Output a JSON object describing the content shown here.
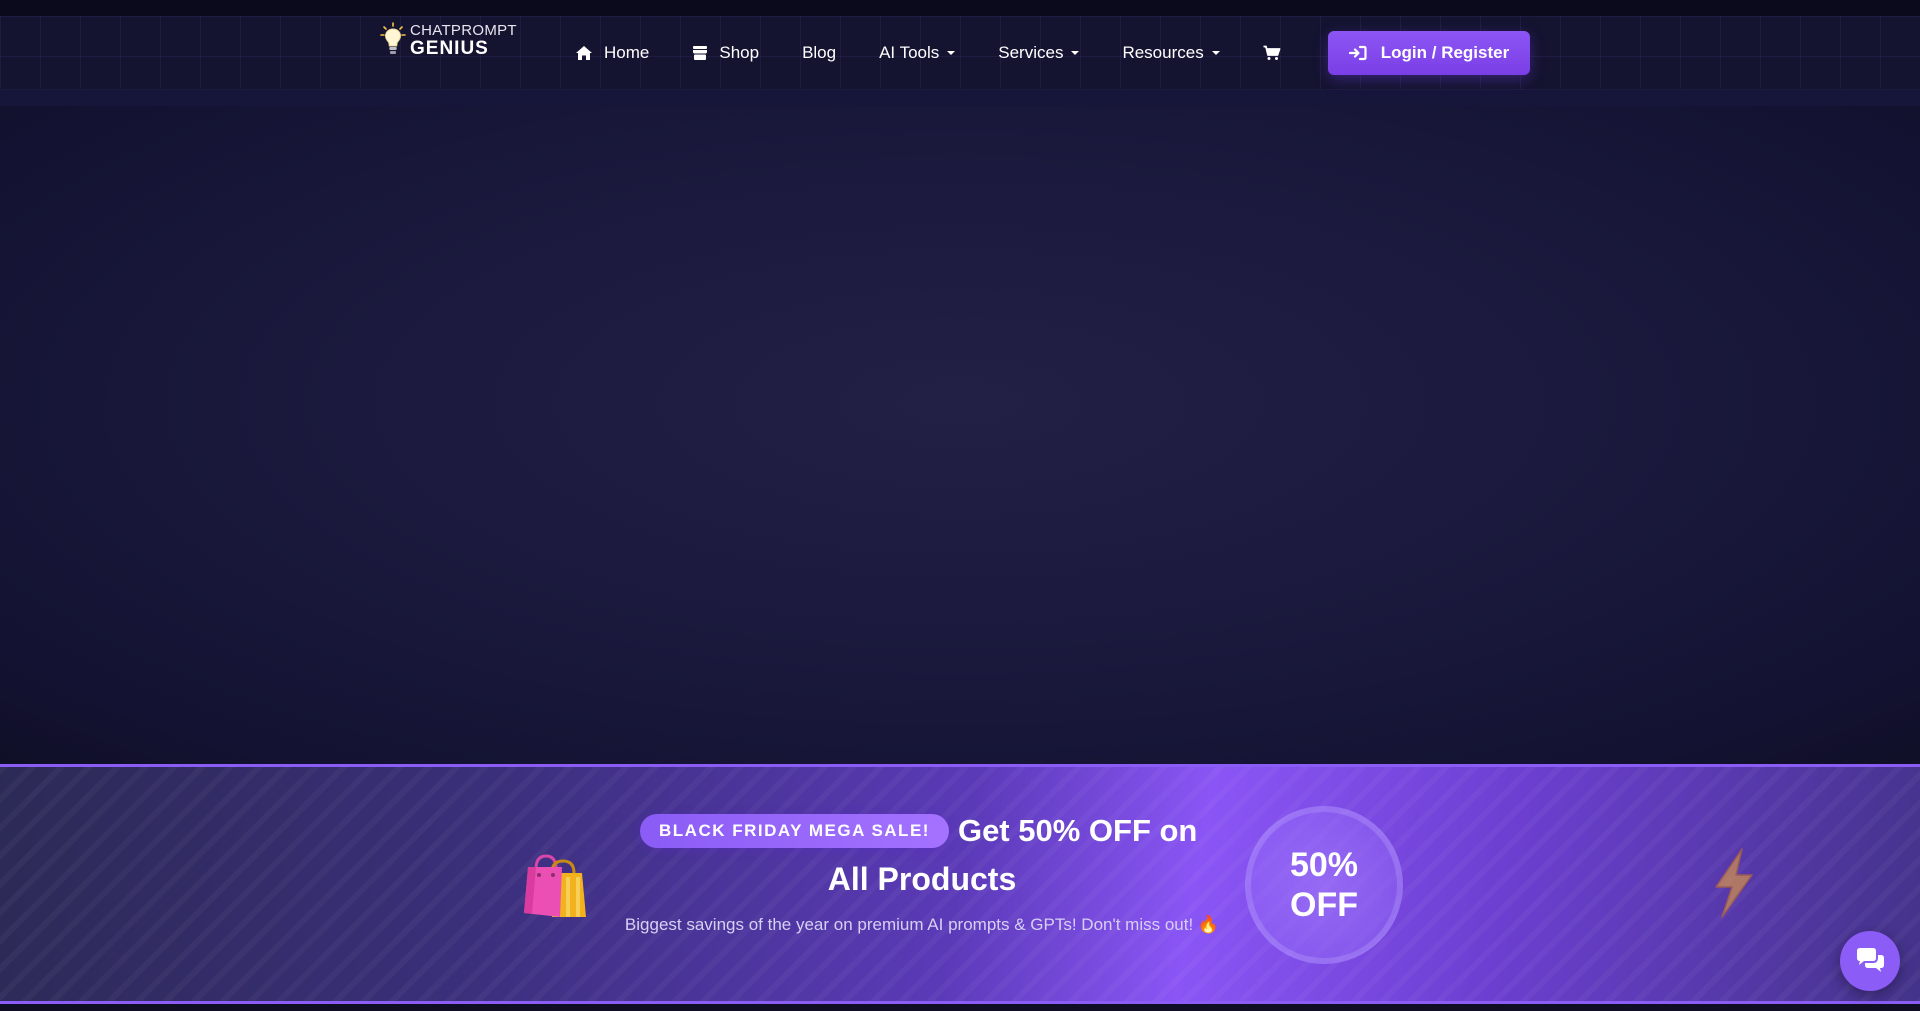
{
  "logo": {
    "line1": "CHATPROMPT",
    "line2": "GENIUS",
    "icon": "lightbulb-icon"
  },
  "nav": {
    "items": [
      {
        "label": "Home",
        "icon": "home-icon"
      },
      {
        "label": "Shop",
        "icon": "store-icon"
      },
      {
        "label": "Blog"
      },
      {
        "label": "AI Tools",
        "dropdown": true
      },
      {
        "label": "Services",
        "dropdown": true
      },
      {
        "label": "Resources",
        "dropdown": true
      }
    ],
    "cart_icon": "cart-icon"
  },
  "login": {
    "label": "Login / Register",
    "icon": "sign-in-icon"
  },
  "banner": {
    "badge": "BLACK FRIDAY MEGA SALE!",
    "headline_part1": "Get 50% OFF on",
    "headline_part2": "All Products",
    "subtext": "Biggest savings of the year on premium AI prompts & GPTs! Don't miss out! 🔥",
    "circle_line1": "50%",
    "circle_line2": "OFF",
    "left_icon": "shopping-bags-icon",
    "right_icon": "lightning-icon"
  },
  "chat": {
    "icon": "chat-bubbles-icon"
  },
  "colors": {
    "accent": "#8b5cf6",
    "nav_bg": "#141330",
    "hero_bg": "#1b1a3e",
    "page_bg": "#0f0e24"
  }
}
